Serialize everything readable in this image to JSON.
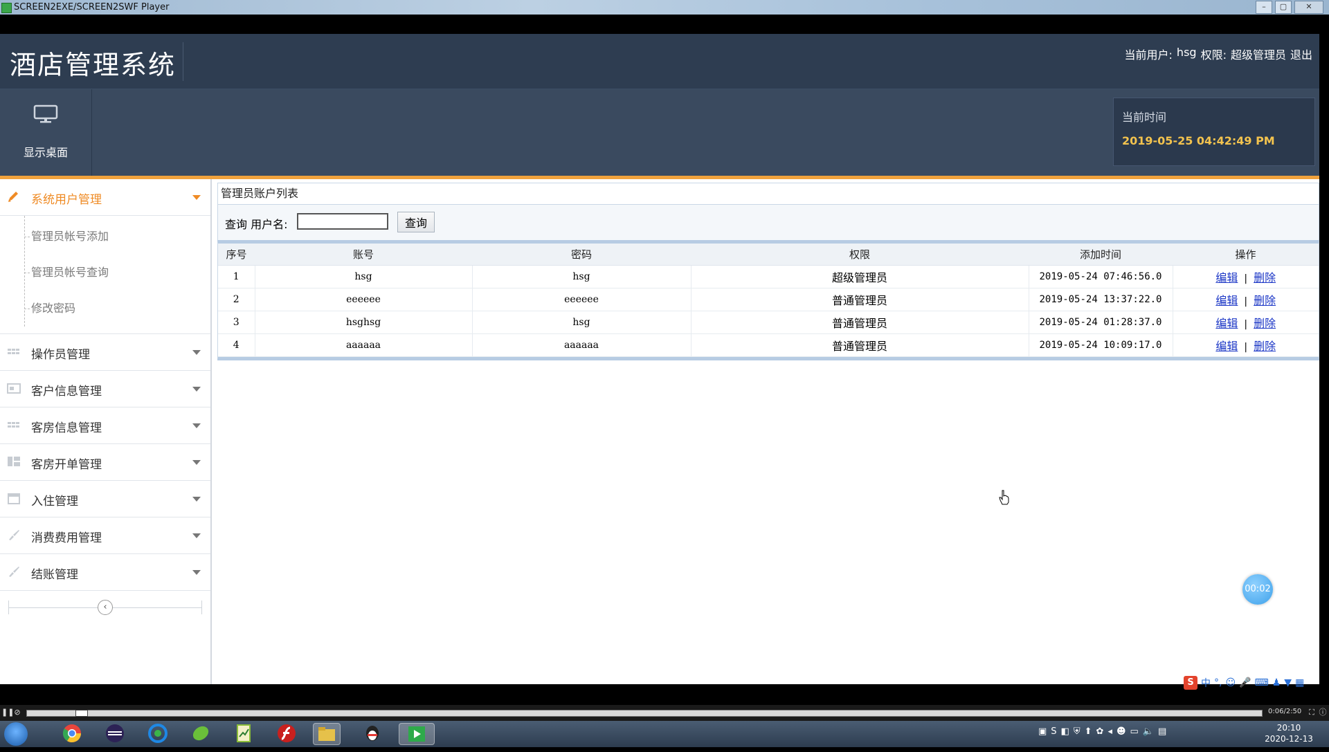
{
  "player": {
    "title": "SCREEN2EXE/SCREEN2SWF Player",
    "time_display": "0:06/2:50"
  },
  "header": {
    "app_title": "酒店管理系统",
    "current_user_label": "当前用户:",
    "username": "hsg",
    "role_label": "权限:",
    "role": "超级管理员",
    "logout": "退出"
  },
  "subbar": {
    "desktop_label": "显示桌面",
    "time_label": "当前时间",
    "time_value": "2019-05-25 04:42:49 PM"
  },
  "sidebar": {
    "items": [
      {
        "label": "系统用户管理",
        "icon": "pencil-icon",
        "active": true
      },
      {
        "label": "操作员管理",
        "icon": "grid-icon"
      },
      {
        "label": "客户信息管理",
        "icon": "card-icon"
      },
      {
        "label": "客房信息管理",
        "icon": "grid-icon"
      },
      {
        "label": "客房开单管理",
        "icon": "blocks-icon"
      },
      {
        "label": "入住管理",
        "icon": "calendar-icon"
      },
      {
        "label": "消费费用管理",
        "icon": "brush-icon"
      },
      {
        "label": "结账管理",
        "icon": "brush-icon"
      }
    ],
    "subitems": [
      "管理员帐号添加",
      "管理员帐号查询",
      "修改密码"
    ],
    "collapse_glyph": "‹"
  },
  "main": {
    "panel_title": "管理员账户列表",
    "search_label": "查询 用户名:",
    "search_value": "",
    "search_button": "查询",
    "columns": [
      "序号",
      "账号",
      "密码",
      "权限",
      "添加时间",
      "操作"
    ],
    "rows": [
      {
        "no": "1",
        "account": "hsg",
        "password": "hsg",
        "role": "超级管理员",
        "added": "2019-05-24 07:46:56.0"
      },
      {
        "no": "2",
        "account": "eeeeee",
        "password": "eeeeee",
        "role": "普通管理员",
        "added": "2019-05-24 13:37:22.0"
      },
      {
        "no": "3",
        "account": "hsghsg",
        "password": "hsg",
        "role": "普通管理员",
        "added": "2019-05-24 01:28:37.0"
      },
      {
        "no": "4",
        "account": "aaaaaa",
        "password": "aaaaaa",
        "role": "普通管理员",
        "added": "2019-05-24 10:09:17.0"
      }
    ],
    "edit_label": "编辑",
    "op_separator": "|",
    "delete_label": "删除"
  },
  "timer_bubble": "00:02",
  "ime": {
    "mode": "中"
  },
  "taskbar": {
    "clock_time": "20:10",
    "clock_date": "2020-12-13",
    "apps": [
      {
        "name": "chrome-icon",
        "color": "#e8453c"
      },
      {
        "name": "eclipse-icon",
        "color": "#2c2255"
      },
      {
        "name": "browser-icon",
        "color": "#1e88e5"
      },
      {
        "name": "leaf-icon",
        "color": "#6abf3a"
      },
      {
        "name": "notepad-icon",
        "color": "#8bbd38"
      },
      {
        "name": "flash-icon",
        "color": "#c8201e"
      },
      {
        "name": "folder-icon",
        "color": "#e6c14a"
      },
      {
        "name": "qq-icon",
        "color": "#222222"
      },
      {
        "name": "player-icon",
        "color": "#2eaa4a"
      }
    ]
  },
  "colors": {
    "header_bg": "#2e3d51",
    "subbar_bg": "#3a4a5f",
    "accent_orange": "#f0a23c",
    "time_yellow": "#f3c34e",
    "link_blue": "#1b36c6"
  }
}
